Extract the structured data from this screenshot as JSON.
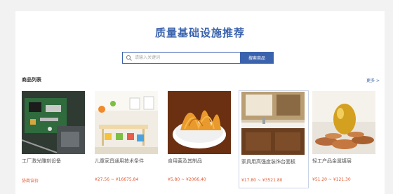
{
  "page": {
    "title": "质量基础设施推荐"
  },
  "search": {
    "placeholder": "请输入关键词",
    "button_label": "搜索商品"
  },
  "section": {
    "title": "商品列表",
    "more_label": "更多 >"
  },
  "products": [
    {
      "name": "工厂激光雕刻设备",
      "price": "协商议价"
    },
    {
      "name": "儿童家具通用技术条件",
      "price": "¥27.56 ~ ¥16675.84"
    },
    {
      "name": "食用菌及其制品",
      "price": "¥5.80 ~ ¥2066.40"
    },
    {
      "name": "家具用高强度装饰台面板",
      "price": "¥17.80 ~ ¥3521.80"
    },
    {
      "name": "轻工产品金属镀层",
      "price": "¥51.20 ~ ¥121.30"
    }
  ],
  "colors": {
    "brand": "#3b63ad",
    "price": "#e4572e",
    "background": "#f2f2f2"
  }
}
